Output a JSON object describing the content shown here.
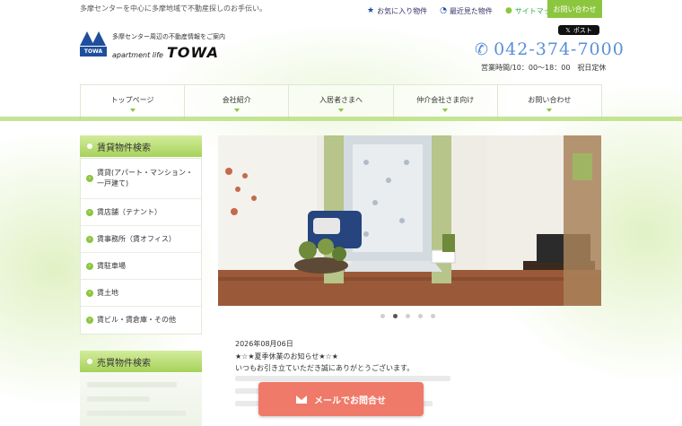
{
  "header": {
    "tagline": "多摩センターを中心に多摩地域で不動産探しのお手伝い。",
    "links": [
      {
        "icon": "star-icon",
        "label": "お気に入り物件"
      },
      {
        "icon": "history-icon",
        "label": "最近見た物件"
      },
      {
        "icon": "bullet-icon",
        "label": "サイトマップ"
      }
    ],
    "contact_tab": "お問い合わせ",
    "logo": {
      "subtitle": "多摩センター周辺の不動産情報をご案内",
      "line": "apartment life",
      "brand": "TOWA",
      "mark_text": "TOWA"
    },
    "x_post": "ポスト",
    "phone": "042-374-7000",
    "hours": "営業時間/10：00～18：00　祝日定休"
  },
  "nav": [
    {
      "label": "トップページ"
    },
    {
      "label": "会社紹介"
    },
    {
      "label": "入居者さまへ"
    },
    {
      "label": "仲介会社さま向け"
    },
    {
      "label": "お問い合わせ"
    }
  ],
  "sidebar": {
    "rent_heading": "賃貸物件検索",
    "rent_items": [
      {
        "label": "賃貸(アパート・マンション・一戸建て)"
      },
      {
        "label": "賃店舗（テナント）"
      },
      {
        "label": "賃事務所（賃オフィス）"
      },
      {
        "label": "賃駐車場"
      },
      {
        "label": "賃土地"
      },
      {
        "label": "賃ビル・賃倉庫・その他"
      }
    ],
    "sale_heading": "売買物件検索"
  },
  "slider": {
    "slide_count": 5,
    "active_index": 1
  },
  "news": {
    "date": "2026年08月06日",
    "title": "★☆★夏季休業のお知らせ★☆★",
    "body": "いつもお引き立ていただき誠にありがとうございます。"
  },
  "cta": {
    "mail_label": "メールでお問合せ"
  },
  "colors": {
    "accent_green": "#8cc63f",
    "brand_blue": "#1f4f9c",
    "phone_blue": "#5a8fd6",
    "cta_red": "#ef7a6a"
  }
}
